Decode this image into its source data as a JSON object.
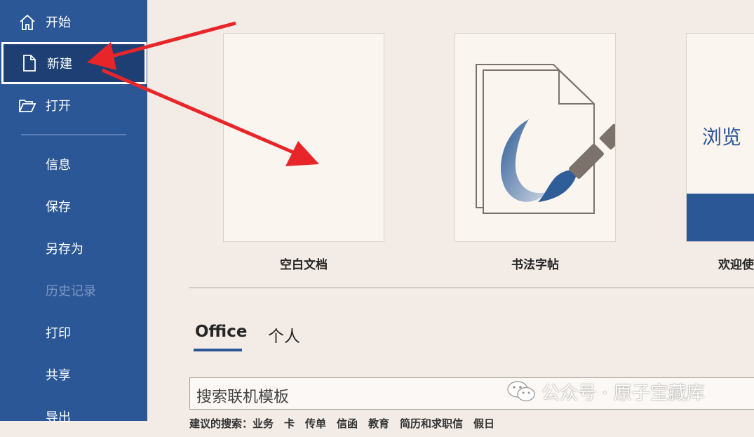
{
  "sidebar": {
    "items": [
      {
        "label": "开始",
        "icon": "home-icon"
      },
      {
        "label": "新建",
        "icon": "new-document-icon",
        "selected": true
      },
      {
        "label": "打开",
        "icon": "open-folder-icon"
      },
      {
        "label": "信息"
      },
      {
        "label": "保存"
      },
      {
        "label": "另存为"
      },
      {
        "label": "历史记录",
        "disabled": true
      },
      {
        "label": "打印"
      },
      {
        "label": "共享"
      },
      {
        "label": "导出"
      }
    ]
  },
  "templates": [
    {
      "caption": "空白文档"
    },
    {
      "caption": "书法字帖"
    },
    {
      "caption": "欢迎使",
      "tile_text": "浏览"
    }
  ],
  "tabs": [
    {
      "label": "Office",
      "active": true
    },
    {
      "label": "个人"
    }
  ],
  "search": {
    "placeholder": "搜索联机模板"
  },
  "suggestions": "建议的搜索：业务　卡　传单　信函　教育　简历和求职信　假日",
  "watermark": {
    "text": "公众号 · 原子宝藏库"
  },
  "colors": {
    "sidebar": "#2b5797",
    "selected": "#1d3f73",
    "background": "#f3ebe5",
    "annotation_arrow": "#e8262a",
    "brand_blue": "#2b5797"
  }
}
